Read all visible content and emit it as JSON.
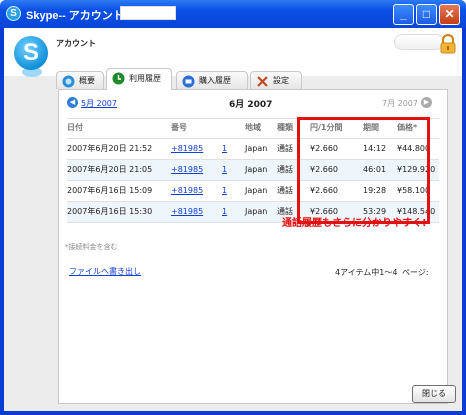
{
  "window": {
    "title": "Skype-- アカウント -",
    "buttons": {
      "minimize": "_",
      "maximize": "□",
      "close": "✕"
    }
  },
  "header": {
    "logo": "S",
    "title": "アカウント"
  },
  "tabs": [
    {
      "label": "概要",
      "icon": "overview-icon",
      "color": "#2a8fd8"
    },
    {
      "label": "利用履歴",
      "icon": "history-icon",
      "color": "#1f8a2a"
    },
    {
      "label": "購入履歴",
      "icon": "cart-icon",
      "color": "#2a6fd8"
    },
    {
      "label": "設定",
      "icon": "tools-icon",
      "color": "#c04a20"
    }
  ],
  "nav": {
    "prev_label": "5月 2007",
    "current_label": "6月 2007",
    "next_label": "7月 2007"
  },
  "table": {
    "headers": [
      "日付",
      "番号",
      "",
      "地域",
      "種類",
      "円/1分間",
      "期間",
      "価格*"
    ],
    "rows": [
      {
        "date": "2007年6月20日 21:52",
        "number": "+81985",
        "count": "1",
        "region": "Japan",
        "type": "通話",
        "rate": "¥2.660",
        "duration": "14:12",
        "price": "¥44.800"
      },
      {
        "date": "2007年6月20日 21:05",
        "number": "+81985",
        "count": "1",
        "region": "Japan",
        "type": "通話",
        "rate": "¥2.660",
        "duration": "46:01",
        "price": "¥129.920"
      },
      {
        "date": "2007年6月16日 15:09",
        "number": "+81985",
        "count": "1",
        "region": "Japan",
        "type": "通話",
        "rate": "¥2.660",
        "duration": "19:28",
        "price": "¥58.100"
      },
      {
        "date": "2007年6月16日 15:30",
        "number": "+81985",
        "count": "1",
        "region": "Japan",
        "type": "通話",
        "rate": "¥2.660",
        "duration": "53:29",
        "price": "¥148.540"
      }
    ]
  },
  "footnote": "*接続料金を含む",
  "export_link": "ファイルへ書き出し",
  "pagination": "4アイテム中1〜4",
  "page_label": "ページ:",
  "callout": "通話履歴もさらに分かりやすく!",
  "close_button": "閉じる",
  "accent_color": "#e31111"
}
